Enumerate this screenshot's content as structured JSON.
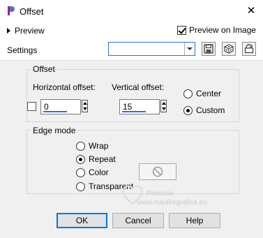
{
  "window": {
    "title": "Offset",
    "close_symbol": "✕"
  },
  "preview": {
    "label": "Preview",
    "on_image_label": "Preview on Image",
    "on_image_checked": true
  },
  "settings": {
    "label": "Settings",
    "preset_value": ""
  },
  "offset_group": {
    "legend": "Offset",
    "horizontal": {
      "label": "Horizontal offset:",
      "value": "0"
    },
    "vertical": {
      "label": "Vertical offset:",
      "value": "15"
    },
    "link_checked": false,
    "center_label": "Center",
    "custom_label": "Custom",
    "selected": "Custom"
  },
  "edge_group": {
    "legend": "Edge mode",
    "options": [
      "Wrap",
      "Repeat",
      "Color",
      "Transparent"
    ],
    "selected": "Repeat"
  },
  "buttons": {
    "ok": "OK",
    "cancel": "Cancel",
    "help": "Help"
  },
  "watermark": {
    "line1": "Pinuccia",
    "line2": "www.maidiregrafica.eu"
  }
}
